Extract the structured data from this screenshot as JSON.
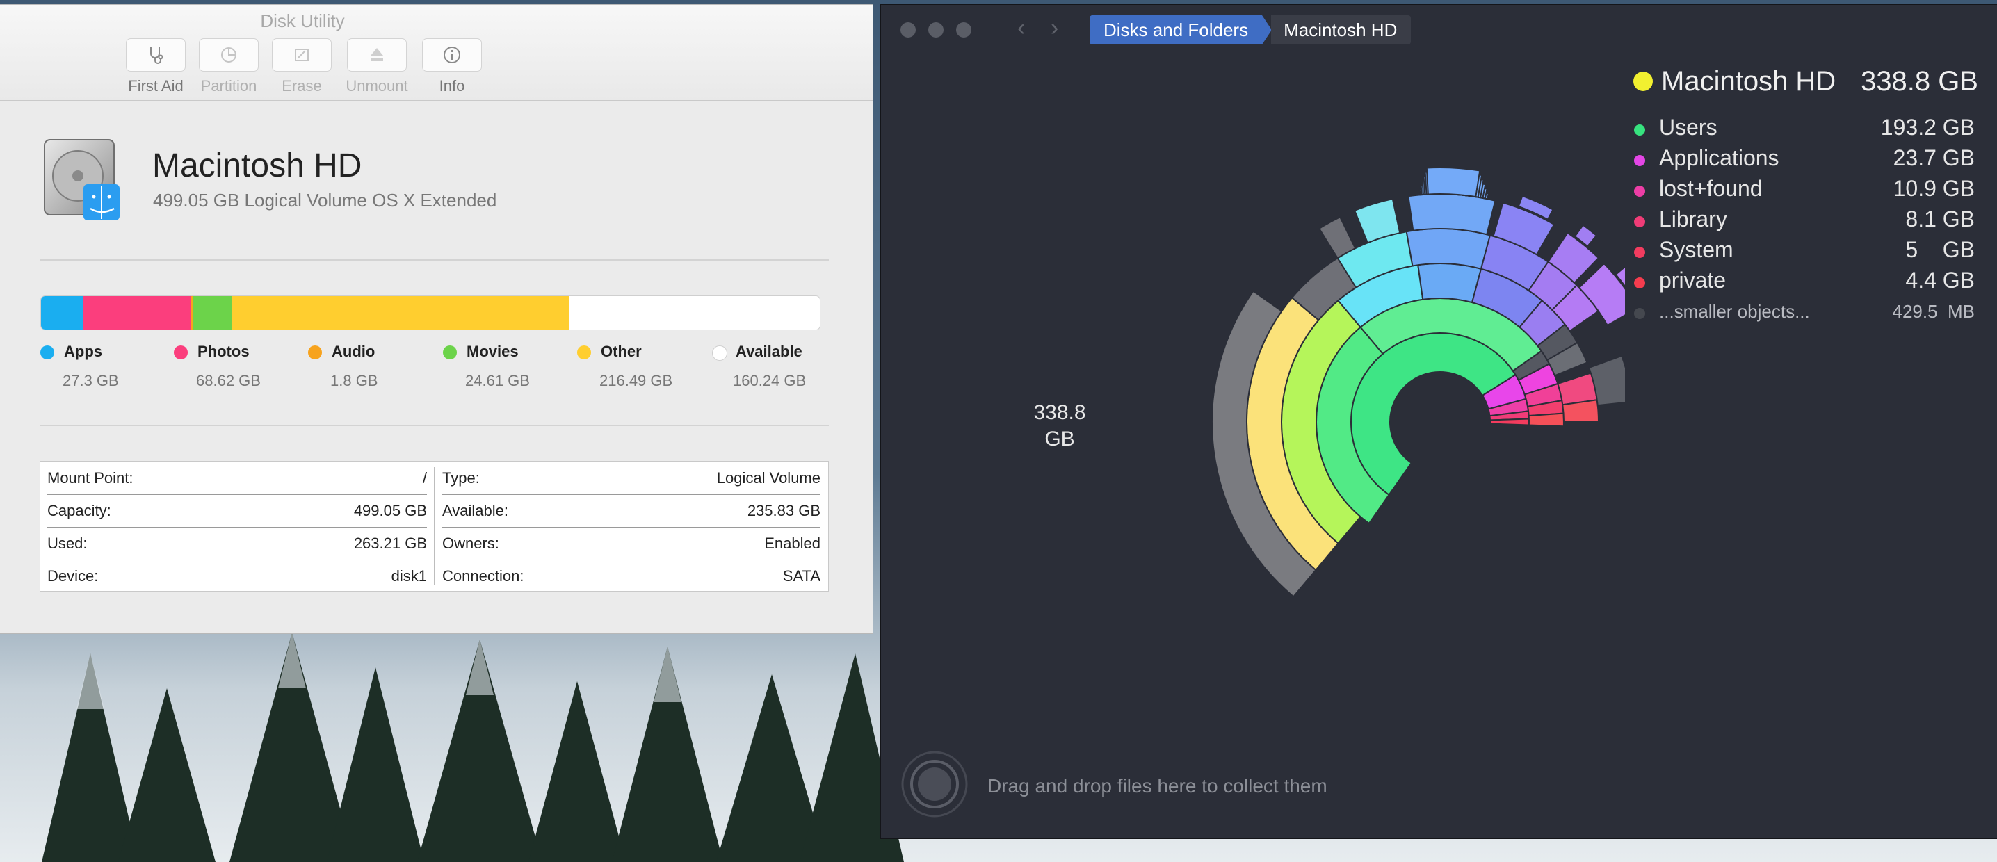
{
  "disk_utility": {
    "window_title": "Disk Utility",
    "toolbar": [
      {
        "label": "First Aid",
        "icon": "stethoscope-icon"
      },
      {
        "label": "Partition",
        "icon": "pie-icon"
      },
      {
        "label": "Erase",
        "icon": "erase-icon"
      },
      {
        "label": "Unmount",
        "icon": "eject-icon"
      },
      {
        "label": "Info",
        "icon": "info-icon"
      }
    ],
    "drive_name": "Macintosh HD",
    "drive_desc": "499.05 GB Logical Volume OS X Extended",
    "usage": [
      {
        "label": "Apps",
        "value": "27.3 GB",
        "gb": 27.3,
        "color": "#1aaef0"
      },
      {
        "label": "Photos",
        "value": "68.62 GB",
        "gb": 68.62,
        "color": "#fb3e7d"
      },
      {
        "label": "Audio",
        "value": "1.8 GB",
        "gb": 1.8,
        "color": "#f7a31e"
      },
      {
        "label": "Movies",
        "value": "24.61 GB",
        "gb": 24.61,
        "color": "#6cd34a"
      },
      {
        "label": "Other",
        "value": "216.49 GB",
        "gb": 216.49,
        "color": "#ffce2f"
      },
      {
        "label": "Available",
        "value": "160.24 GB",
        "gb": 160.24,
        "color": "#ffffff"
      }
    ],
    "info": {
      "left": [
        {
          "k": "Mount Point:",
          "v": "/"
        },
        {
          "k": "Capacity:",
          "v": "499.05 GB"
        },
        {
          "k": "Used:",
          "v": "263.21 GB"
        },
        {
          "k": "Device:",
          "v": "disk1"
        }
      ],
      "right": [
        {
          "k": "Type:",
          "v": "Logical Volume"
        },
        {
          "k": "Available:",
          "v": "235.83 GB"
        },
        {
          "k": "Owners:",
          "v": "Enabled"
        },
        {
          "k": "Connection:",
          "v": "SATA"
        }
      ]
    }
  },
  "daisy": {
    "breadcrumb": [
      "Disks and Folders",
      "Macintosh HD"
    ],
    "center": [
      "338.8",
      "GB"
    ],
    "title": "Macintosh HD",
    "total": "338.8 GB",
    "items": [
      {
        "name": "Users",
        "size": "193.2 GB",
        "color": "#37e37f"
      },
      {
        "name": "Applications",
        "size": "23.7 GB",
        "color": "#e446e6"
      },
      {
        "name": "lost+found",
        "size": "10.9 GB",
        "color": "#ed3ea6"
      },
      {
        "name": "Library",
        "size": "8.1 GB",
        "color": "#f03c77"
      },
      {
        "name": "System",
        "size": "5    GB",
        "color": "#f23c5f"
      },
      {
        "name": "private",
        "size": "4.4 GB",
        "color": "#f53c4e"
      },
      {
        "name": "...smaller objects...",
        "size": "429.5  MB",
        "color": "#45484f"
      }
    ],
    "drop_text": "Drag and drop files here to collect them"
  }
}
